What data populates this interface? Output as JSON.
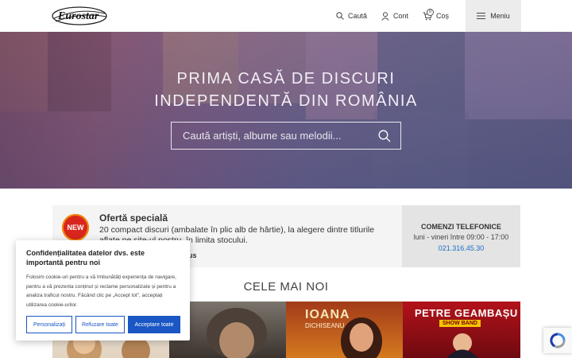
{
  "header": {
    "logo_text": "Eurostar",
    "search_label": "Caută",
    "account_label": "Cont",
    "cart_label": "Coș",
    "cart_count": "0",
    "menu_label": "Meniu"
  },
  "hero": {
    "title_line1": "PRIMA CASĂ DE DISCURI",
    "title_line2": "INDEPENDENTĂ DIN ROMÂNIA",
    "search_placeholder": "Caută artiști, albume sau melodii..."
  },
  "offer": {
    "badge": "NEW",
    "title": "Ofertă specială",
    "text": "20 compact discuri (ambalate în plic alb de hârtie), la alegere dintre titlurile aflate pe site-ul nostru, în limita stocului.",
    "link_fragment": "us"
  },
  "phone_orders": {
    "title": "COMENZI TELEFONICE",
    "hours": "luni - vineri între 09:00 - 17:00",
    "number": "021.316.45.30"
  },
  "newest": {
    "title": "CELE MAI NOI",
    "albums": [
      {
        "name": "",
        "sub": ""
      },
      {
        "name": "",
        "sub": ""
      },
      {
        "name": "IOANA",
        "sub": "DICHISEANU"
      },
      {
        "name": "PETRE GEAMBAȘU",
        "sub": "SHOW BAND"
      }
    ]
  },
  "cookie": {
    "title": "Confidențialitatea datelor dvs. este importantă pentru noi",
    "text": "Folosim cookie-uri pentru a vă îmbunătăți experiența de navigare, pentru a vă prezenta conținut și reclame personalizate și pentru a analiza traficul nostru. Făcând clic pe „Accept tot”, acceptați utilizarea cookie-urilor.",
    "btn_customize": "Personalizați",
    "btn_reject": "Refuzare toate",
    "btn_accept": "Acceptare toate"
  },
  "colors": {
    "accent_blue": "#1a56c4",
    "badge_red": "#d9261c",
    "phone_link": "#1a6fc0"
  }
}
